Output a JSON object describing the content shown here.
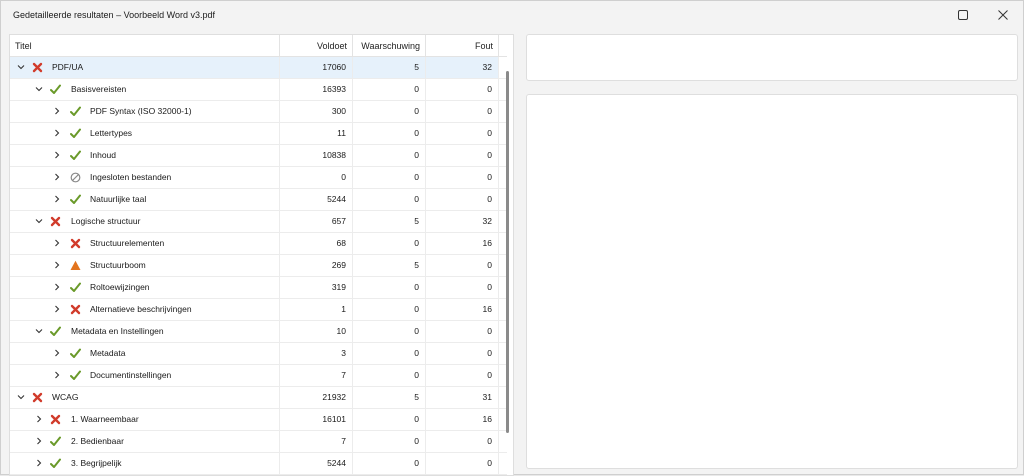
{
  "window": {
    "title": "Gedetailleerde resultaten – Voorbeeld Word v3.pdf",
    "maximize_icon": "maximize-icon",
    "close_icon": "close-icon"
  },
  "grid": {
    "columns": {
      "title": "Titel",
      "pass": "Voldoet",
      "warn": "Waarschuwing",
      "fail": "Fout"
    },
    "rows": [
      {
        "label": "PDF/UA",
        "level": 0,
        "expanded": true,
        "status": "fail",
        "pass": "17060",
        "warn": "5",
        "fail": "32",
        "selected": true
      },
      {
        "label": "Basisvereisten",
        "level": 1,
        "expanded": true,
        "status": "pass",
        "pass": "16393",
        "warn": "0",
        "fail": "0"
      },
      {
        "label": "PDF Syntax (ISO 32000-1)",
        "level": 2,
        "expanded": false,
        "status": "pass",
        "pass": "300",
        "warn": "0",
        "fail": "0"
      },
      {
        "label": "Lettertypes",
        "level": 2,
        "expanded": false,
        "status": "pass",
        "pass": "11",
        "warn": "0",
        "fail": "0"
      },
      {
        "label": "Inhoud",
        "level": 2,
        "expanded": false,
        "status": "pass",
        "pass": "10838",
        "warn": "0",
        "fail": "0"
      },
      {
        "label": "Ingesloten bestanden",
        "level": 2,
        "expanded": false,
        "status": "na",
        "pass": "0",
        "warn": "0",
        "fail": "0"
      },
      {
        "label": "Natuurlijke taal",
        "level": 2,
        "expanded": false,
        "status": "pass",
        "pass": "5244",
        "warn": "0",
        "fail": "0"
      },
      {
        "label": "Logische structuur",
        "level": 1,
        "expanded": true,
        "status": "fail",
        "pass": "657",
        "warn": "5",
        "fail": "32"
      },
      {
        "label": "Structuurelementen",
        "level": 2,
        "expanded": false,
        "status": "fail",
        "pass": "68",
        "warn": "0",
        "fail": "16"
      },
      {
        "label": "Structuurboom",
        "level": 2,
        "expanded": false,
        "status": "warn",
        "pass": "269",
        "warn": "5",
        "fail": "0"
      },
      {
        "label": "Roltoewijzingen",
        "level": 2,
        "expanded": false,
        "status": "pass",
        "pass": "319",
        "warn": "0",
        "fail": "0"
      },
      {
        "label": "Alternatieve beschrijvingen",
        "level": 2,
        "expanded": false,
        "status": "fail",
        "pass": "1",
        "warn": "0",
        "fail": "16"
      },
      {
        "label": "Metadata en Instellingen",
        "level": 1,
        "expanded": true,
        "status": "pass",
        "pass": "10",
        "warn": "0",
        "fail": "0"
      },
      {
        "label": "Metadata",
        "level": 2,
        "expanded": false,
        "status": "pass",
        "pass": "3",
        "warn": "0",
        "fail": "0"
      },
      {
        "label": "Documentinstellingen",
        "level": 2,
        "expanded": false,
        "status": "pass",
        "pass": "7",
        "warn": "0",
        "fail": "0"
      },
      {
        "label": "WCAG",
        "level": 0,
        "expanded": true,
        "status": "fail",
        "pass": "21932",
        "warn": "5",
        "fail": "31"
      },
      {
        "label": "1. Waarneembaar",
        "level": 1,
        "expanded": false,
        "status": "fail",
        "pass": "16101",
        "warn": "0",
        "fail": "16"
      },
      {
        "label": "2. Bedienbaar",
        "level": 1,
        "expanded": false,
        "status": "pass",
        "pass": "7",
        "warn": "0",
        "fail": "0"
      },
      {
        "label": "3. Begrijpelijk",
        "level": 1,
        "expanded": false,
        "status": "pass",
        "pass": "5244",
        "warn": "0",
        "fail": "0"
      }
    ]
  },
  "colors": {
    "pass": "#6a9a2a",
    "fail": "#d13b2b",
    "warn": "#e3741d",
    "na": "#8a8a8a",
    "selection": "#e6f1fb"
  },
  "icons": {
    "pass": "check-icon",
    "fail": "cross-icon",
    "warn": "warning-triangle-icon",
    "na": "not-applicable-icon",
    "expanded": "chevron-down-icon",
    "collapsed": "chevron-right-icon"
  }
}
